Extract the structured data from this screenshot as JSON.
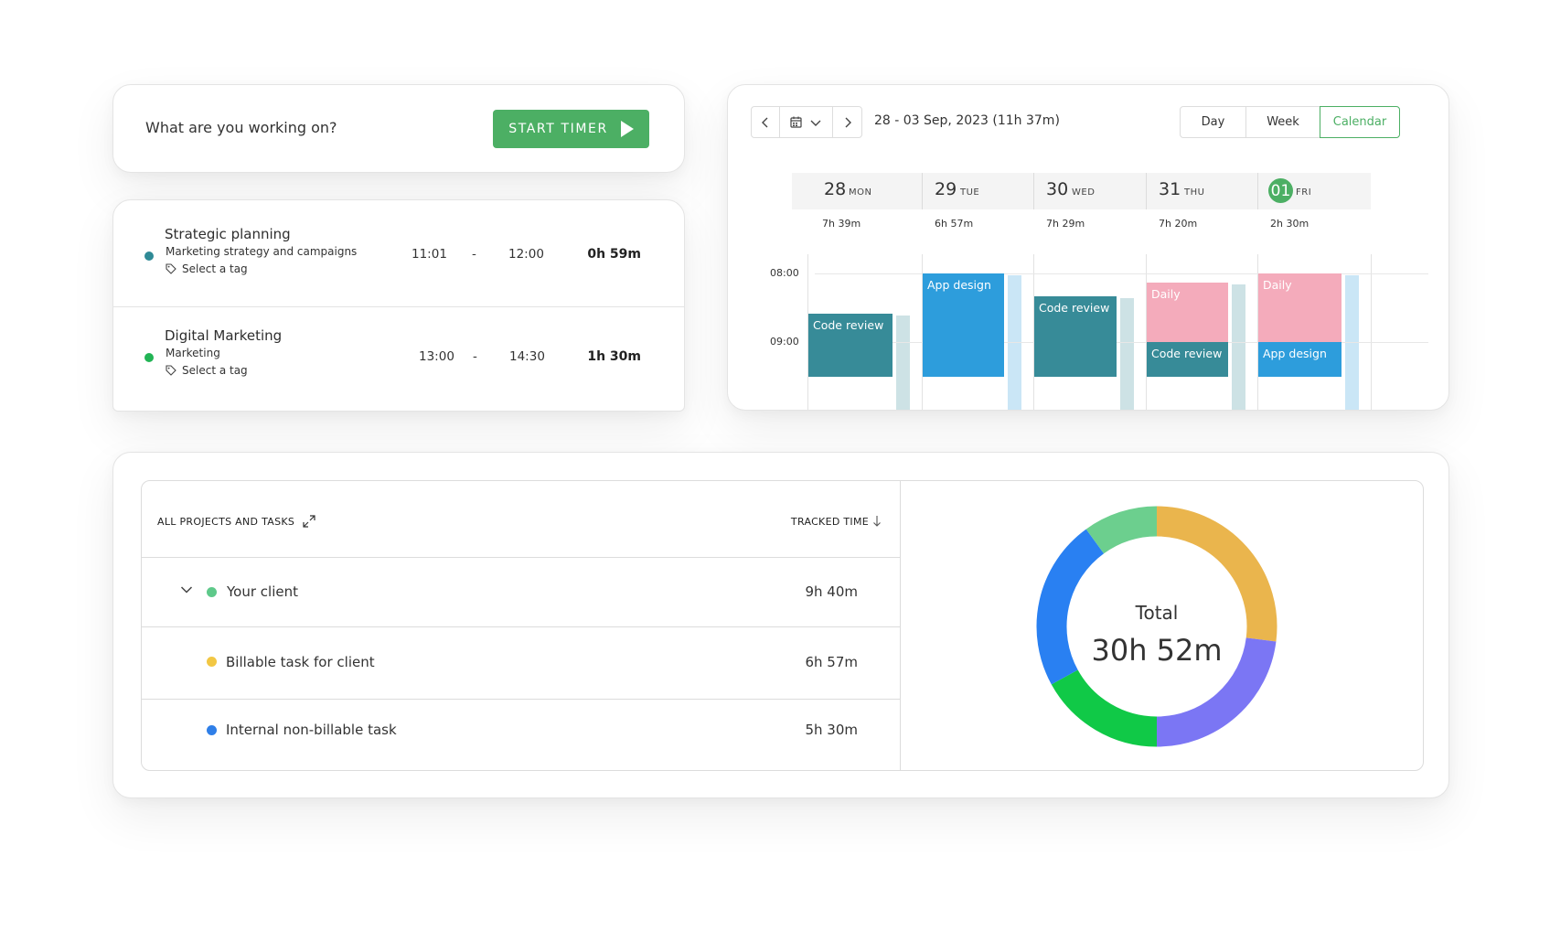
{
  "timer": {
    "prompt": "What are you working on?",
    "start_label": "START TIMER"
  },
  "entries": [
    {
      "title": "Strategic planning",
      "subtitle": "Marketing strategy and campaigns",
      "tag_label": "Select a tag",
      "start": "11:01",
      "sep": "-",
      "end": "12:00",
      "duration": "0h 59m",
      "color": "#2f8a96"
    },
    {
      "title": "Digital Marketing",
      "subtitle": "Marketing",
      "tag_label": "Select a tag",
      "start": "13:00",
      "sep": "-",
      "end": "14:30",
      "duration": "1h 30m",
      "color": "#22b455"
    }
  ],
  "calendar": {
    "date_range": "28 - 03 Sep, 2023 (11h 37m)",
    "views": {
      "day": "Day",
      "week": "Week",
      "calendar": "Calendar"
    },
    "active_view": "calendar",
    "days": [
      {
        "num": "28",
        "dow": "MON",
        "total": "7h 39m",
        "today": false
      },
      {
        "num": "29",
        "dow": "TUE",
        "total": "6h 57m",
        "today": false
      },
      {
        "num": "30",
        "dow": "WED",
        "total": "7h 29m",
        "today": false
      },
      {
        "num": "31",
        "dow": "THU",
        "total": "7h 20m",
        "today": false
      },
      {
        "num": "01",
        "dow": "FRI",
        "total": "2h 30m",
        "today": true
      }
    ],
    "hours": [
      "08:00",
      "09:00"
    ],
    "blocks": [
      {
        "day": 0,
        "label": "Code review",
        "start": "08:35",
        "end": "09:30",
        "color": "#378b98"
      },
      {
        "day": 1,
        "label": "App design",
        "start": "08:00",
        "end": "09:30",
        "color": "#2d9ddc"
      },
      {
        "day": 2,
        "label": "Code review",
        "start": "08:20",
        "end": "09:30",
        "color": "#378b98"
      },
      {
        "day": 3,
        "label": "Daily",
        "start": "08:08",
        "end": "09:00",
        "color": "#f4abbb"
      },
      {
        "day": 3,
        "label": "Code review",
        "start": "09:00",
        "end": "09:30",
        "color": "#378b98"
      },
      {
        "day": 4,
        "label": "Daily",
        "start": "08:00",
        "end": "09:00",
        "color": "#f4abbb"
      },
      {
        "day": 4,
        "label": "App design",
        "start": "09:00",
        "end": "09:30",
        "color": "#2d9ddc"
      }
    ],
    "colors": {
      "today": "#4caf64",
      "accent": "#4caf64"
    }
  },
  "report": {
    "col_projects": "ALL PROJECTS AND TASKS",
    "col_tracked": "TRACKED TIME",
    "rows": [
      {
        "label": "Your client",
        "value": "9h 40m",
        "color": "#5ec98a",
        "expandable": true
      },
      {
        "label": "Billable task for client",
        "value": "6h 57m",
        "color": "#f2c744",
        "expandable": false
      },
      {
        "label": "Internal non-billable task",
        "value": "5h 30m",
        "color": "#2f7fe8",
        "expandable": false
      }
    ],
    "total_label": "Total",
    "total_value": "30h 52m",
    "donut_segments": [
      {
        "value": 27,
        "color": "#eab54d"
      },
      {
        "value": 23,
        "color": "#7b76f4"
      },
      {
        "value": 17,
        "color": "#10c947"
      },
      {
        "value": 23,
        "color": "#2980f2"
      },
      {
        "value": 10,
        "color": "#6ccf8e"
      }
    ]
  }
}
